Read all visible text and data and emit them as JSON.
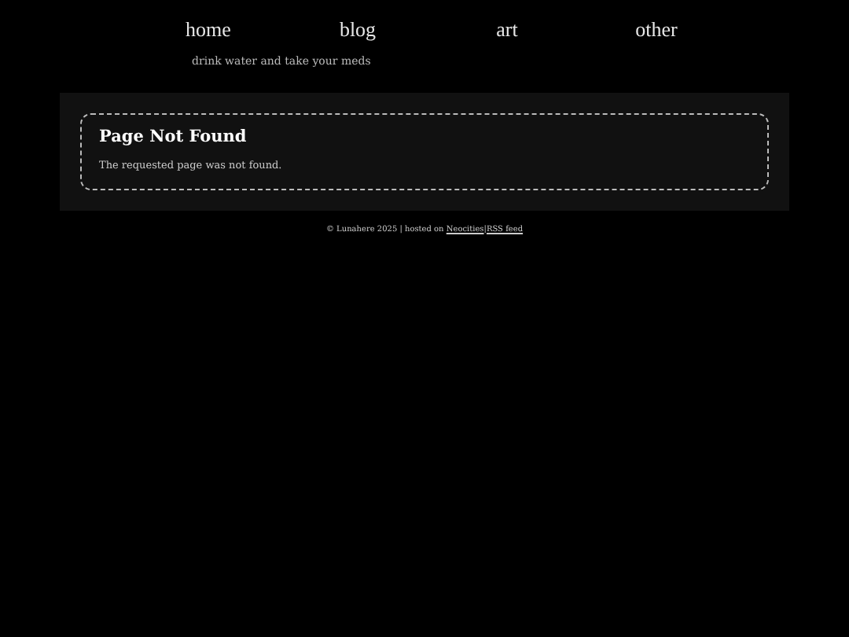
{
  "nav": [
    {
      "label": "home"
    },
    {
      "label": "blog"
    },
    {
      "label": "art"
    },
    {
      "label": "other"
    }
  ],
  "tagline": "drink water and take your meds",
  "error_card": {
    "title": "Page Not Found",
    "message": "The requested page was not found."
  },
  "footer": {
    "text": "© Lunahere 2025 | hosted on",
    "links": [
      "Neocities",
      "RSS feed"
    ],
    "separator": "|"
  }
}
